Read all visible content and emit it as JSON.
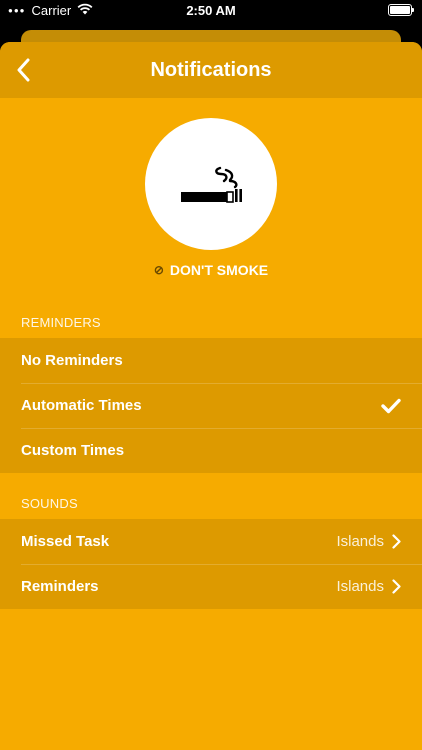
{
  "status_bar": {
    "carrier": "Carrier",
    "time": "2:50 AM"
  },
  "nav": {
    "title": "Notifications"
  },
  "habit": {
    "icon": "cigarette-icon",
    "label": "DON'T SMOKE"
  },
  "reminders": {
    "header": "REMINDERS",
    "items": [
      {
        "label": "No Reminders",
        "selected": false
      },
      {
        "label": "Automatic Times",
        "selected": true
      },
      {
        "label": "Custom Times",
        "selected": false
      }
    ]
  },
  "sounds": {
    "header": "SOUNDS",
    "items": [
      {
        "label": "Missed Task",
        "value": "Islands"
      },
      {
        "label": "Reminders",
        "value": "Islands"
      }
    ]
  },
  "colors": {
    "background": "#f6ab00",
    "bar": "#dd9a00",
    "text": "#ffffff"
  }
}
